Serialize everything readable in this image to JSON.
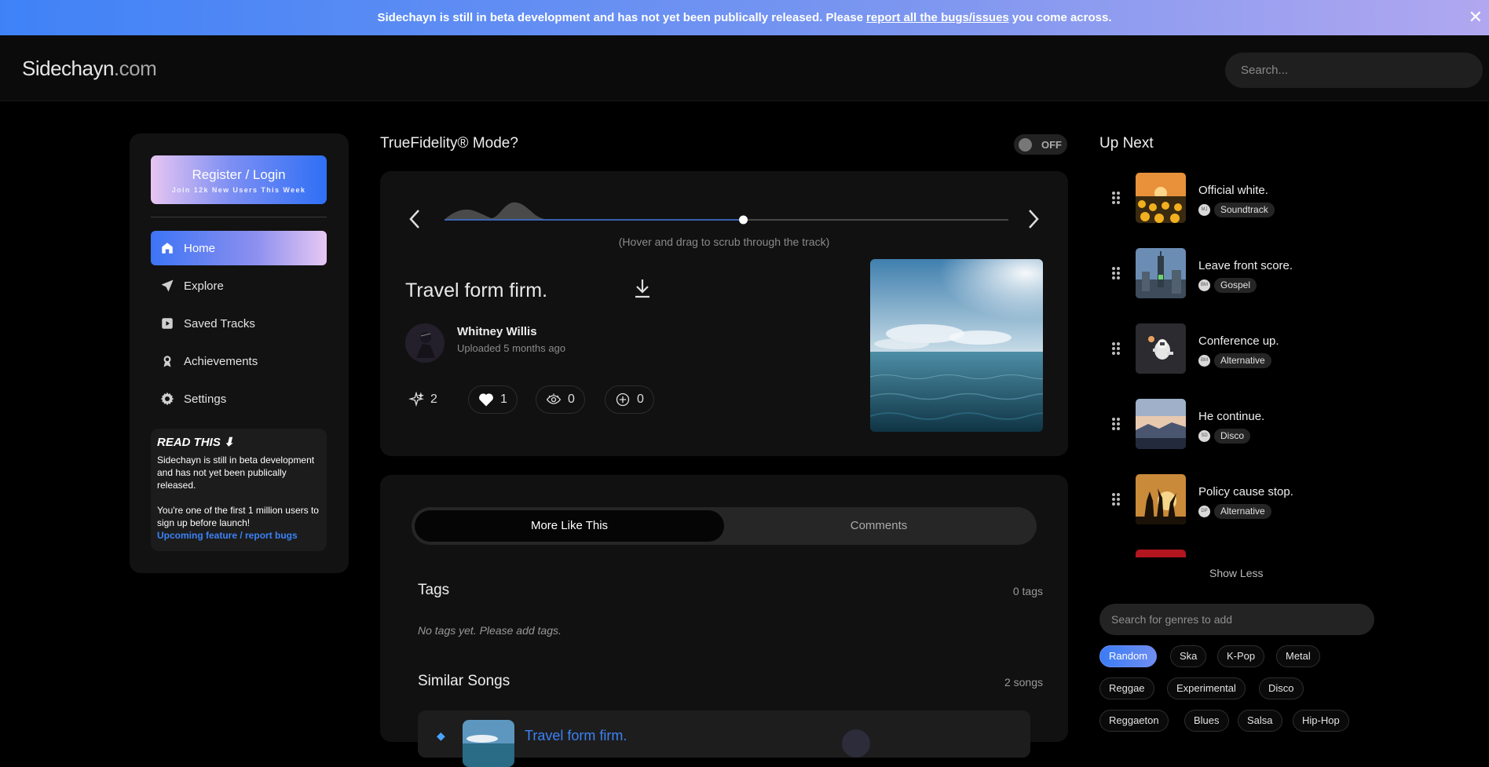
{
  "banner": {
    "text_before": "Sidechayn is still in beta development and has not yet been publically released. Please",
    "link": "report all the bugs/issues",
    "text_after": "you come across.",
    "close_glyph": "✕"
  },
  "header": {
    "logo_main": "Sidechayn",
    "logo_domain": ".com",
    "search_placeholder": "Search..."
  },
  "sidebar": {
    "register_title": "Register / Login",
    "register_subtitle": "Join 12k New Users This Week",
    "items": [
      {
        "label": "Home",
        "icon": "home-icon",
        "active": true
      },
      {
        "label": "Explore",
        "icon": "send-icon"
      },
      {
        "label": "Saved Tracks",
        "icon": "saved-tracks-icon"
      },
      {
        "label": "Achievements",
        "icon": "award-icon"
      },
      {
        "label": "Settings",
        "icon": "gear-icon"
      }
    ],
    "read_title": "READ THIS ⬇",
    "read_p1": "Sidechayn is still in beta development and has not yet been publically released.",
    "read_p2": "You're one of the first 1 million users to sign up before launch!",
    "read_link": "Upcoming feature / report bugs"
  },
  "player": {
    "truefidelity_label": "TrueFidelity® Mode?",
    "toggle_state": "OFF",
    "scrub_hint": "(Hover and drag to scrub through the track)",
    "progress": 0.53,
    "track_title": "Travel form firm.",
    "artist": "Whitney Willis",
    "uploaded": "Uploaded 5 months ago",
    "stats": [
      {
        "icon": "sparkle-icon",
        "value": "2"
      },
      {
        "icon": "heart-icon",
        "value": "1"
      },
      {
        "icon": "eye-icon",
        "value": "0"
      },
      {
        "icon": "plus-circle-icon",
        "value": "0"
      }
    ]
  },
  "bottom": {
    "tab_active": "More Like This",
    "tab_inactive": "Comments",
    "tags_heading": "Tags",
    "tags_count": "0 tags",
    "no_tags": "No tags yet. Please add tags.",
    "similar_heading": "Similar Songs",
    "similar_count": "2 songs",
    "similar_first_title": "Travel form firm."
  },
  "upnext": {
    "heading": "Up Next",
    "items": [
      {
        "title": "Official white.",
        "initials": "MJ",
        "genre": "Soundtrack"
      },
      {
        "title": "Leave front score.",
        "initials": "BM",
        "genre": "Gospel"
      },
      {
        "title": "Conference up.",
        "initials": "BM",
        "genre": "Alternative"
      },
      {
        "title": "He continue.",
        "initials": "SD",
        "genre": "Disco"
      },
      {
        "title": "Policy cause stop.",
        "initials": "DP",
        "genre": "Alternative"
      }
    ],
    "show_less": "Show Less",
    "genre_search_placeholder": "Search for genres to add",
    "genres": [
      "Random",
      "Ska",
      "K-Pop",
      "Metal",
      "Reggae",
      "Experimental",
      "Disco",
      "Reggaeton",
      "Blues",
      "Salsa",
      "Hip-Hop"
    ],
    "selected_genre": "Random"
  },
  "colors": {
    "accent_blue": "#3b82f6",
    "banner_start": "#3f82f7",
    "banner_end": "#b1a7f0",
    "panel": "#111111"
  }
}
